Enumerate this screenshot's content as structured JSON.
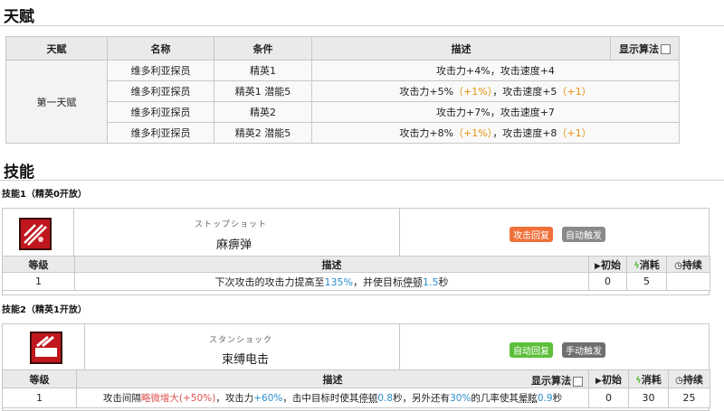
{
  "talent_section": {
    "title": "天赋"
  },
  "talent_table": {
    "headers": [
      "天赋",
      "名称",
      "条件",
      "描述",
      "显示算法"
    ],
    "group_label": "第一天赋",
    "rows": [
      {
        "name": "维多利亚探员",
        "cond": "精英1",
        "desc_a": "攻击力+4%，攻击速度+4",
        "desc_p1": "",
        "desc_b": "",
        "desc_p2": ""
      },
      {
        "name": "维多利亚探员",
        "cond": "精英1 潜能5",
        "desc_a": "攻击力+5%",
        "desc_p1": "（+1%）",
        "desc_b": "，攻击速度+5",
        "desc_p2": "（+1）"
      },
      {
        "name": "维多利亚探员",
        "cond": "精英2",
        "desc_a": "攻击力+7%，攻击速度+7",
        "desc_p1": "",
        "desc_b": "",
        "desc_p2": ""
      },
      {
        "name": "维多利亚探员",
        "cond": "精英2 潜能5",
        "desc_a": "攻击力+8%",
        "desc_p1": "（+1%）",
        "desc_b": "，攻击速度+8",
        "desc_p2": "（+1）"
      }
    ]
  },
  "skills_section": {
    "title": "技能"
  },
  "skill1": {
    "title": "技能1（精英0开放）",
    "jp_name": "ストップショット",
    "name": "麻痹弹",
    "badge1": "攻击回复",
    "badge2": "自动触发",
    "headers": {
      "level": "等级",
      "desc": "描述",
      "init": "初始",
      "cost": "消耗",
      "dur": "持续"
    },
    "row": {
      "level": "1",
      "d1": "下次攻击的攻击力提高至",
      "d2": "135%",
      "d3": "，并使目标",
      "d4": "停顿",
      "d5": "1.5",
      "d6": "秒",
      "init": "0",
      "cost": "5",
      "dur": ""
    },
    "colors": {
      "badge1": "#f0703a",
      "badge2": "#8a8a8a"
    }
  },
  "skill2": {
    "title": "技能2（精英1开放）",
    "jp_name": "スタンショック",
    "name": "束缚电击",
    "badge1": "自动回复",
    "badge2": "手动触发",
    "headers": {
      "level": "等级",
      "desc": "描述",
      "algo": "显示算法",
      "init": "初始",
      "cost": "消耗",
      "dur": "持续"
    },
    "row": {
      "level": "1",
      "d1": "攻击间隔",
      "d2": "略微增大",
      "d3": "(+50%)",
      "d4": "，攻击力",
      "d5": "+60%",
      "d6": "，击中目标时使其",
      "d7": "停顿",
      "d8": "0.8",
      "d9": "秒，另外还有",
      "d10": "30%",
      "d11": "的几率使其",
      "d12": "晕眩",
      "d13": "0.9",
      "d14": "秒",
      "init": "0",
      "cost": "30",
      "dur": "25"
    },
    "colors": {
      "badge1": "#5cbf3a",
      "badge2": "#6f6f6f"
    }
  }
}
